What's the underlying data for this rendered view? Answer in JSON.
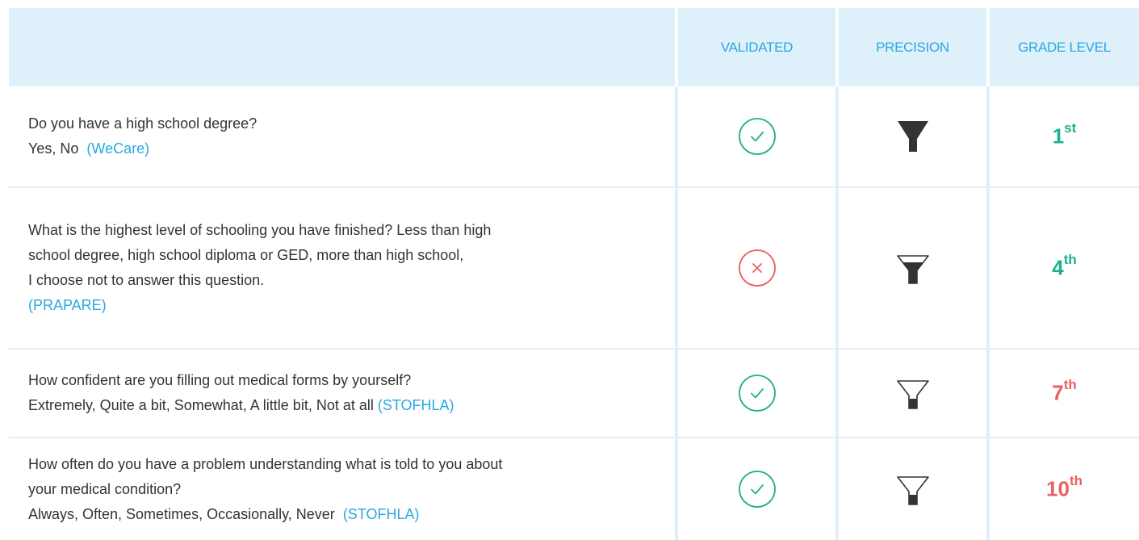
{
  "header": {
    "col_question": "",
    "col_validated": "VALIDATED",
    "col_precision": "PRECISION",
    "col_grade": "GRADE LEVEL"
  },
  "rows": [
    {
      "lines": [
        "Do you have a high school degree?",
        "Yes, No "
      ],
      "source": "(WeCare)",
      "validated": "check",
      "precision": "filled",
      "grade_num": "1",
      "grade_suffix": "st",
      "grade_color": "#1fb08e"
    },
    {
      "lines": [
        "What is the highest level of schooling you have finished? Less than high",
        "school degree, high school diploma or GED, more than high school,",
        "I choose not to answer this question."
      ],
      "source": "(PRAPARE)",
      "validated": "cross",
      "precision": "half",
      "grade_num": "4",
      "grade_suffix": "th",
      "grade_color": "#1fb08e"
    },
    {
      "lines": [
        "How confident are you filling out medical forms by yourself?",
        "Extremely, Quite a bit, Somewhat, A little bit, Not at all "
      ],
      "source": "(STOFHLA)",
      "validated": "check",
      "precision": "outline",
      "grade_num": "7",
      "grade_suffix": "th",
      "grade_color": "#ec5f5f"
    },
    {
      "lines": [
        "How often do you have a problem understanding what is told to you about",
        "your medical condition?",
        "Always, Often, Sometimes, Occasionally, Never "
      ],
      "source": "(STOFHLA)",
      "validated": "check",
      "precision": "outline",
      "grade_num": "10",
      "grade_suffix": "th",
      "grade_color": "#ec5f5f"
    }
  ],
  "colors": {
    "header_bg": "#def0fa",
    "accent_blue": "#2aa8e0",
    "check_green": "#1fb08e",
    "cross_red": "#ec5f5f"
  }
}
